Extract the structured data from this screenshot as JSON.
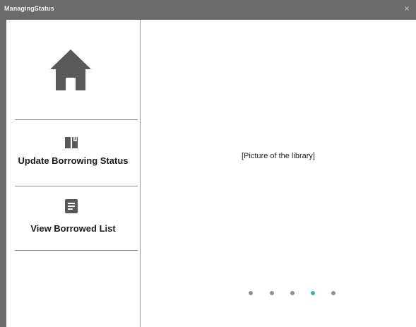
{
  "window": {
    "title": "ManagingStatus",
    "close_glyph": "×"
  },
  "sidebar": {
    "home": {
      "icon": "home-icon"
    },
    "items": [
      {
        "label": "Update Borrowing Status",
        "icon": "book-icon"
      },
      {
        "label": "View Borrowed List",
        "icon": "list-icon"
      }
    ]
  },
  "main": {
    "picture_placeholder": "[Picture of the library]",
    "carousel": {
      "count": 5,
      "active_index": 3
    }
  },
  "colors": {
    "titlebar": "#6b6b6b",
    "icon": "#595959",
    "accent_dot": "#2bb3c8",
    "inactive_dot": "#8f8f8f"
  }
}
